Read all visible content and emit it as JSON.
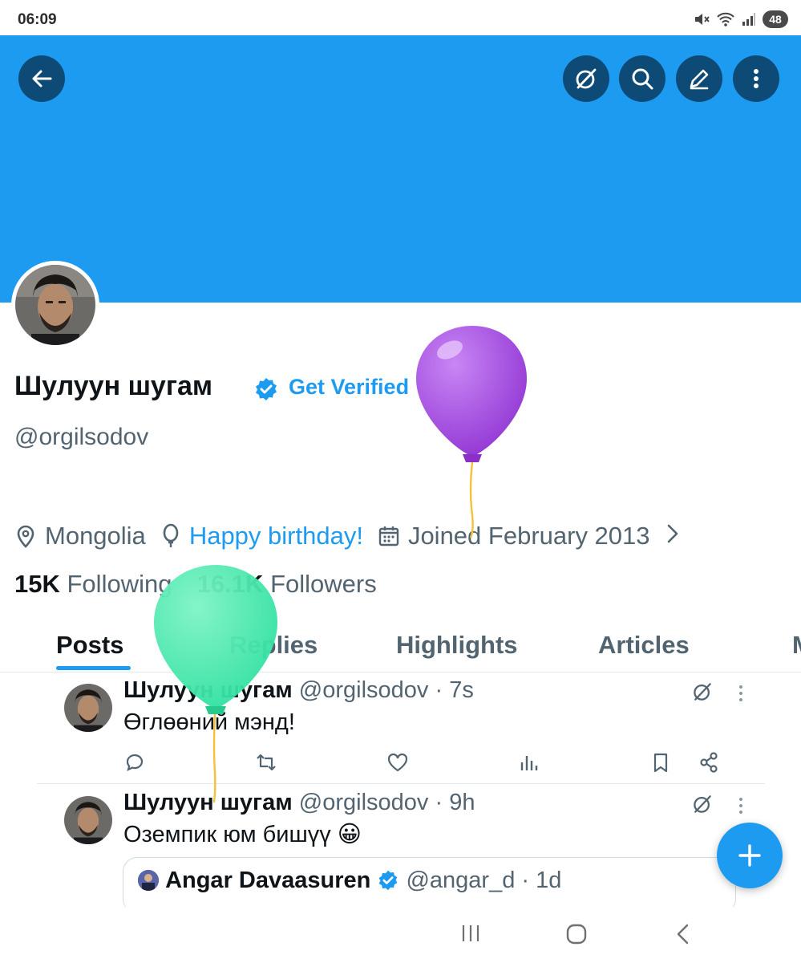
{
  "status_bar": {
    "time": "06:09",
    "battery": "48"
  },
  "profile": {
    "display_name": "Шулуун шугам",
    "get_verified": "Get Verified",
    "handle": "@orgilsodov",
    "location": "Mongolia",
    "birthday": "Happy birthday!",
    "joined": "Joined February 2013",
    "following_count": "15K",
    "following_label": "Following",
    "followers_count": "16.1K",
    "followers_label": "Followers"
  },
  "tabs": [
    {
      "label": "Posts",
      "active": true
    },
    {
      "label": "Replies"
    },
    {
      "label": "Highlights"
    },
    {
      "label": "Articles"
    },
    {
      "label": "M"
    }
  ],
  "posts": [
    {
      "name": "Шулуун шугам",
      "handle": "@orgilsodov",
      "time": "7s",
      "text": "Өглөөний мэнд!"
    },
    {
      "name": "Шулуун шугам",
      "handle": "@orgilsodov",
      "time": "9h",
      "text": "Оземпик юм бишүү 😀",
      "quote": {
        "name": "Angar Davaasuren",
        "handle": "@angar_d",
        "time": "1d"
      }
    }
  ],
  "colors": {
    "accent": "#1d9bf0",
    "banner": "#1d9bf0",
    "header_button": "#0d4a75",
    "balloon_purple": "#a64de0",
    "balloon_green": "#3ee6a8"
  },
  "icons": {
    "header": [
      "back-arrow-icon",
      "grok-icon",
      "search-icon",
      "edit-icon",
      "more-vertical-icon"
    ],
    "meta": [
      "location-pin-icon",
      "balloon-icon",
      "calendar-icon",
      "chevron-right-icon"
    ],
    "actions": [
      "reply-icon",
      "repost-icon",
      "like-icon",
      "views-icon",
      "bookmark-icon",
      "share-icon"
    ]
  }
}
